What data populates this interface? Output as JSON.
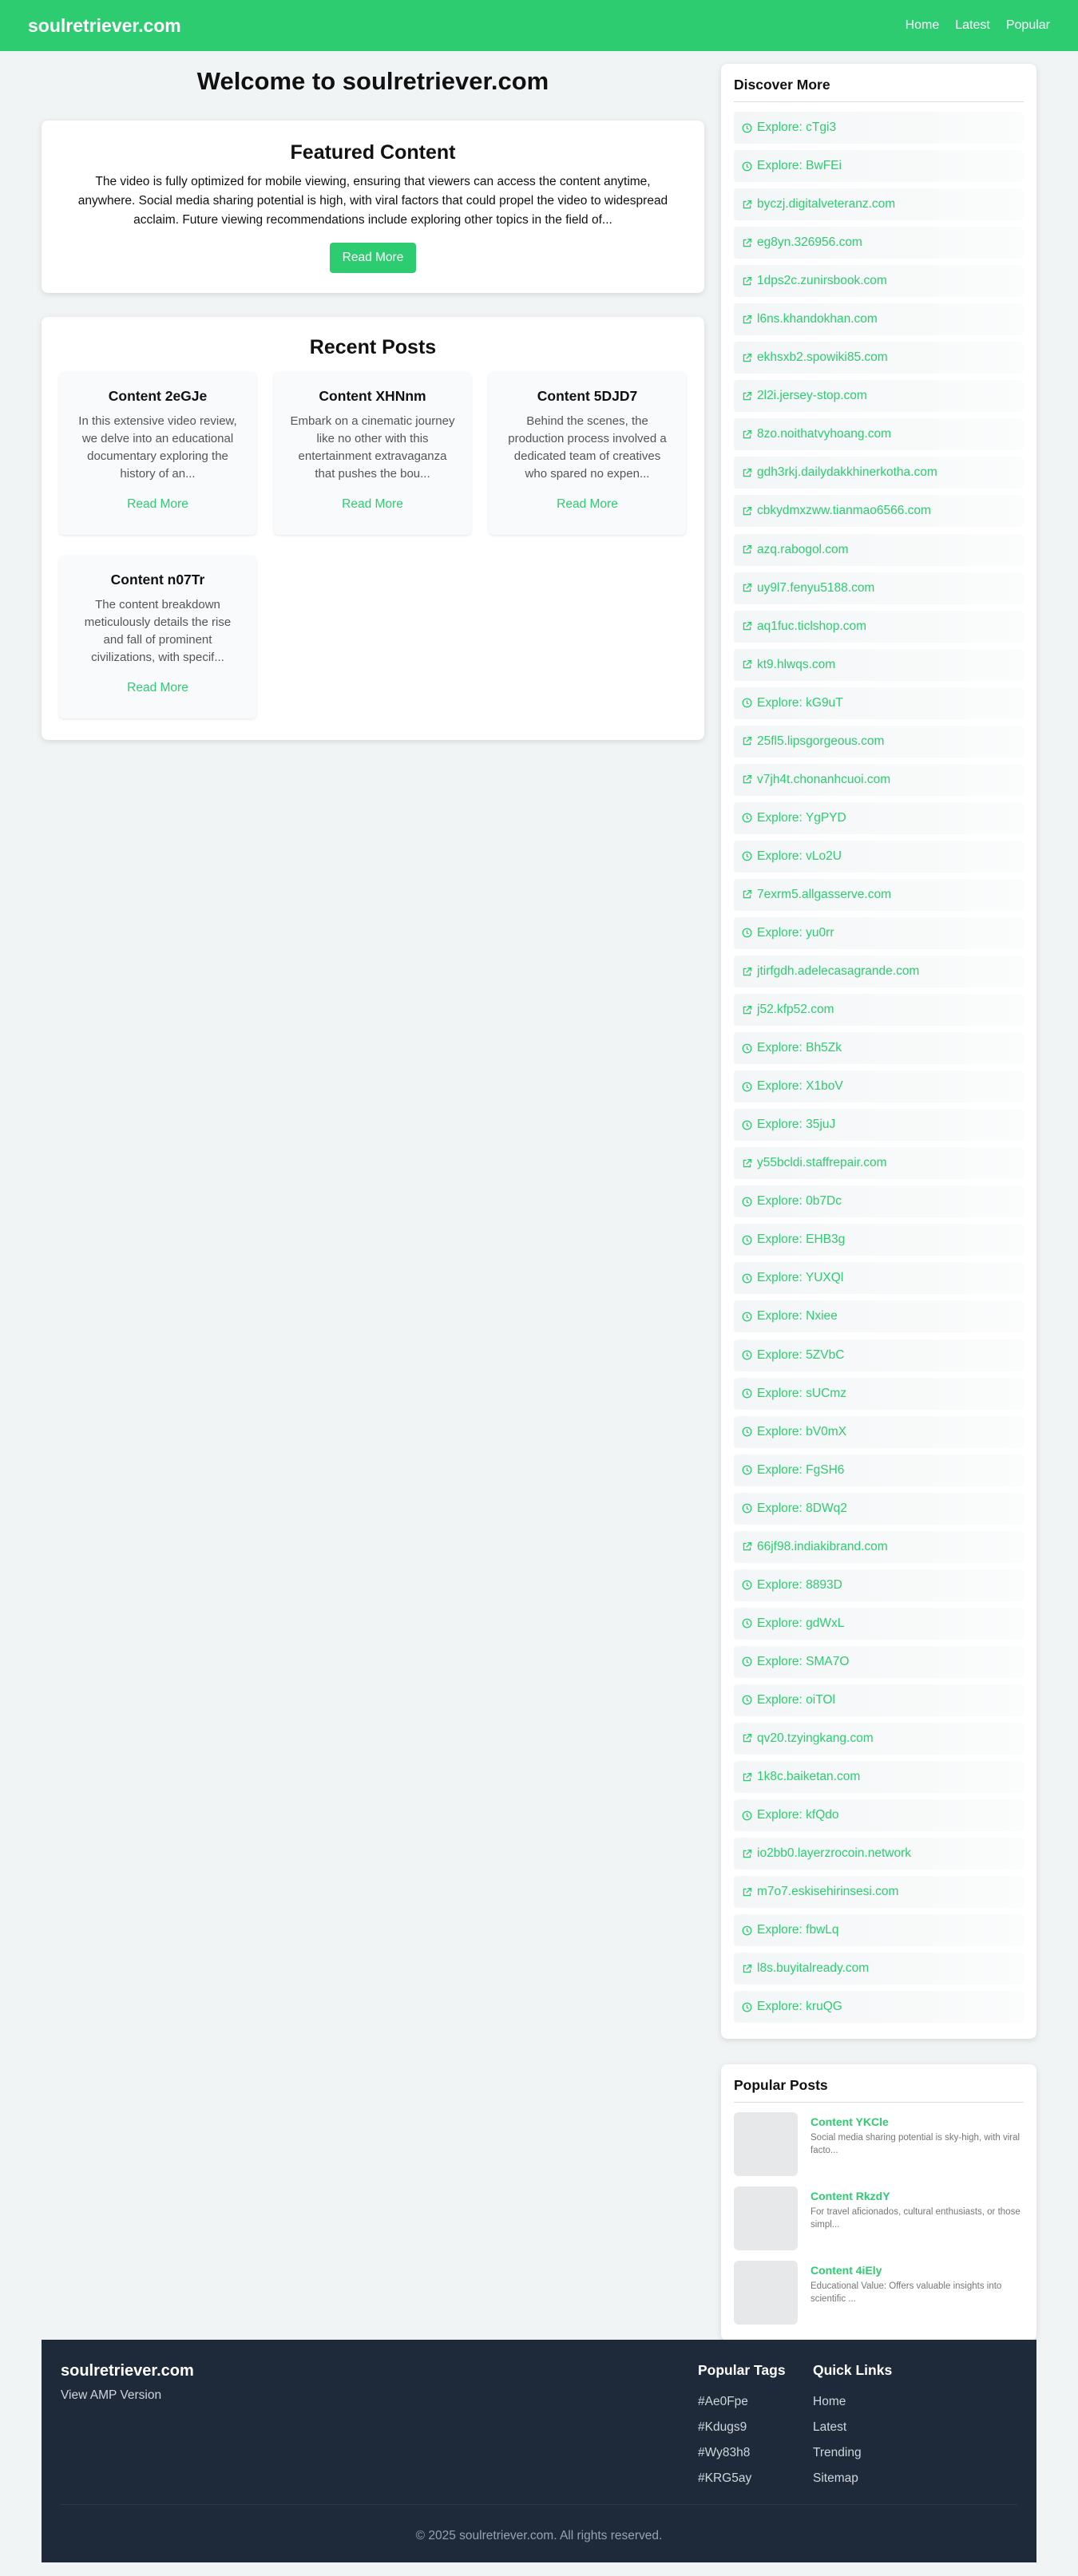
{
  "header": {
    "brand": "soulretriever.com",
    "nav": [
      "Home",
      "Latest",
      "Popular"
    ]
  },
  "main": {
    "title": "Welcome to soulretriever.com",
    "featured": {
      "heading": "Featured Content",
      "text": "The video is fully optimized for mobile viewing, ensuring that viewers can access the content anytime, anywhere. Social media sharing potential is high, with viral factors that could propel the video to widespread acclaim. Future viewing recommendations include exploring other topics in the field of...",
      "button": "Read More"
    },
    "recent": {
      "heading": "Recent Posts",
      "posts": [
        {
          "title": "Content 2eGJe",
          "excerpt": "In this extensive video review, we delve into an educational documentary exploring the history of an...",
          "link": "Read More"
        },
        {
          "title": "Content XHNnm",
          "excerpt": "Embark on a cinematic journey like no other with this entertainment extravaganza that pushes the bou...",
          "link": "Read More"
        },
        {
          "title": "Content 5DJD7",
          "excerpt": "Behind the scenes, the production process involved a dedicated team of creatives who spared no expen...",
          "link": "Read More"
        },
        {
          "title": "Content n07Tr",
          "excerpt": "The content breakdown meticulously details the rise and fall of prominent civilizations, with specif...",
          "link": "Read More"
        }
      ]
    }
  },
  "sidebar": {
    "discover_title": "Discover More",
    "links": [
      {
        "icon": "compass-icon",
        "text": "Explore: cTgi3"
      },
      {
        "icon": "compass-icon",
        "text": "Explore: BwFEi"
      },
      {
        "icon": "external-link-icon",
        "text": "byczj.digitalveteranz.com"
      },
      {
        "icon": "external-link-icon",
        "text": "eg8yn.326956.com"
      },
      {
        "icon": "external-link-icon",
        "text": "1dps2c.zunirsbook.com"
      },
      {
        "icon": "external-link-icon",
        "text": "l6ns.khandokhan.com"
      },
      {
        "icon": "external-link-icon",
        "text": "ekhsxb2.spowiki85.com"
      },
      {
        "icon": "external-link-icon",
        "text": "2l2i.jersey-stop.com"
      },
      {
        "icon": "external-link-icon",
        "text": "8zo.noithatvyhoang.com"
      },
      {
        "icon": "external-link-icon",
        "text": "gdh3rkj.dailydakkhinerkotha.com"
      },
      {
        "icon": "external-link-icon",
        "text": "cbkydmxzww.tianmao6566.com"
      },
      {
        "icon": "external-link-icon",
        "text": "azq.rabogol.com"
      },
      {
        "icon": "external-link-icon",
        "text": "uy9l7.fenyu5188.com"
      },
      {
        "icon": "external-link-icon",
        "text": "aq1fuc.ticlshop.com"
      },
      {
        "icon": "external-link-icon",
        "text": "kt9.hlwqs.com"
      },
      {
        "icon": "compass-icon",
        "text": "Explore: kG9uT"
      },
      {
        "icon": "external-link-icon",
        "text": "25fl5.lipsgorgeous.com"
      },
      {
        "icon": "external-link-icon",
        "text": "v7jh4t.chonanhcuoi.com"
      },
      {
        "icon": "compass-icon",
        "text": "Explore: YgPYD"
      },
      {
        "icon": "compass-icon",
        "text": "Explore: vLo2U"
      },
      {
        "icon": "external-link-icon",
        "text": "7exrm5.allgasserve.com"
      },
      {
        "icon": "compass-icon",
        "text": "Explore: yu0rr"
      },
      {
        "icon": "external-link-icon",
        "text": "jtirfgdh.adelecasagrande.com"
      },
      {
        "icon": "external-link-icon",
        "text": "j52.kfp52.com"
      },
      {
        "icon": "compass-icon",
        "text": "Explore: Bh5Zk"
      },
      {
        "icon": "compass-icon",
        "text": "Explore: X1boV"
      },
      {
        "icon": "compass-icon",
        "text": "Explore: 35juJ"
      },
      {
        "icon": "external-link-icon",
        "text": "y55bcldi.staffrepair.com"
      },
      {
        "icon": "compass-icon",
        "text": "Explore: 0b7Dc"
      },
      {
        "icon": "compass-icon",
        "text": "Explore: EHB3g"
      },
      {
        "icon": "compass-icon",
        "text": "Explore: YUXQl"
      },
      {
        "icon": "compass-icon",
        "text": "Explore: Nxiee"
      },
      {
        "icon": "compass-icon",
        "text": "Explore: 5ZVbC"
      },
      {
        "icon": "compass-icon",
        "text": "Explore: sUCmz"
      },
      {
        "icon": "compass-icon",
        "text": "Explore: bV0mX"
      },
      {
        "icon": "compass-icon",
        "text": "Explore: FgSH6"
      },
      {
        "icon": "compass-icon",
        "text": "Explore: 8DWq2"
      },
      {
        "icon": "external-link-icon",
        "text": "66jf98.indiakibrand.com"
      },
      {
        "icon": "compass-icon",
        "text": "Explore: 8893D"
      },
      {
        "icon": "compass-icon",
        "text": "Explore: gdWxL"
      },
      {
        "icon": "compass-icon",
        "text": "Explore: SMA7O"
      },
      {
        "icon": "compass-icon",
        "text": "Explore: oiTOl"
      },
      {
        "icon": "external-link-icon",
        "text": "qv20.tzyingkang.com"
      },
      {
        "icon": "external-link-icon",
        "text": "1k8c.baiketan.com"
      },
      {
        "icon": "compass-icon",
        "text": "Explore: kfQdo"
      },
      {
        "icon": "external-link-icon",
        "text": "io2bb0.layerzrocoin.network"
      },
      {
        "icon": "external-link-icon",
        "text": "m7o7.eskisehirinsesi.com"
      },
      {
        "icon": "compass-icon",
        "text": "Explore: fbwLq"
      },
      {
        "icon": "external-link-icon",
        "text": "l8s.buyitalready.com"
      },
      {
        "icon": "compass-icon",
        "text": "Explore: kruQG"
      }
    ],
    "popular_title": "Popular Posts",
    "popular": [
      {
        "title": "Content YKCle",
        "text": "Social media sharing potential is sky-high, with viral facto..."
      },
      {
        "title": "Content RkzdY",
        "text": "For travel aficionados, cultural enthusiasts, or those simpl..."
      },
      {
        "title": "Content 4iEly",
        "text": "Educational Value: Offers valuable insights into scientific ..."
      }
    ]
  },
  "footer": {
    "brand": "soulretriever.com",
    "amp": "View AMP Version",
    "tags_title": "Popular Tags",
    "tags": [
      "#Ae0Fpe",
      "#Kdugs9",
      "#Wy83h8",
      "#KRG5ay"
    ],
    "links_title": "Quick Links",
    "links": [
      "Home",
      "Latest",
      "Trending",
      "Sitemap"
    ],
    "copyright": "© 2025 soulretriever.com. All rights reserved."
  },
  "colors": {
    "accent": "#2ecc71",
    "footer_bg": "#1e2a3a",
    "page_bg": "#f1f4f5"
  }
}
